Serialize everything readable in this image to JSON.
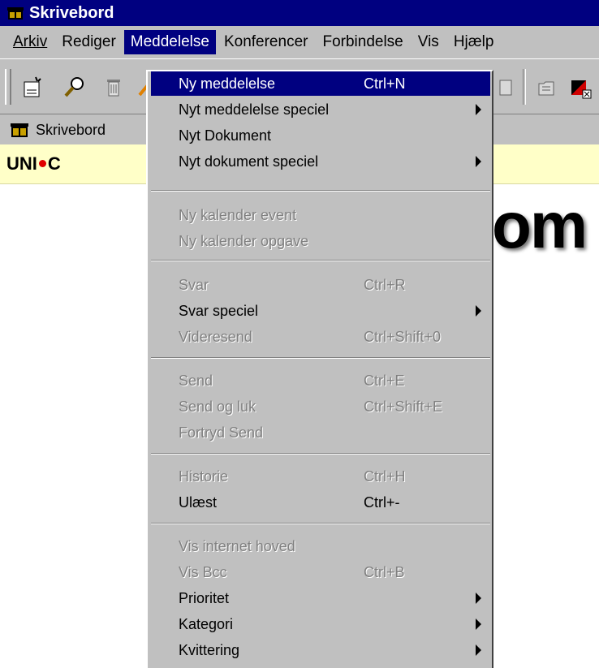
{
  "window": {
    "title": "Skrivebord"
  },
  "menubar": {
    "items": [
      {
        "label": "Arkiv"
      },
      {
        "label": "Rediger"
      },
      {
        "label": "Meddelelse"
      },
      {
        "label": "Konferencer"
      },
      {
        "label": "Forbindelse"
      },
      {
        "label": "Vis"
      },
      {
        "label": "Hjælp"
      }
    ]
  },
  "toolbar": {
    "icons": [
      "new-document-icon",
      "search-icon",
      "delete-icon",
      "paint-icon",
      "document-icon",
      "folder-icon",
      "red-black-icon"
    ]
  },
  "location": {
    "label": "Skrivebord"
  },
  "brand": {
    "left": "UNI",
    "right": "C",
    "dot_color": "#e00000"
  },
  "background_text": "om",
  "dropdown": {
    "items": [
      {
        "label": "Ny meddelelse",
        "shortcut": "Ctrl+N",
        "enabled": true,
        "highlighted": true,
        "submenu": false
      },
      {
        "label": "Nyt meddelelse speciel",
        "shortcut": "",
        "enabled": true,
        "submenu": true
      },
      {
        "label": "Nyt Dokument",
        "shortcut": "",
        "enabled": true,
        "submenu": false
      },
      {
        "label": "Nyt dokument speciel",
        "shortcut": "",
        "enabled": true,
        "submenu": true
      },
      {
        "label": "Ny kalender event",
        "shortcut": "",
        "enabled": false,
        "submenu": false
      },
      {
        "label": "Ny kalender opgave",
        "shortcut": "",
        "enabled": false,
        "submenu": false
      },
      {
        "label": "Svar",
        "shortcut": "Ctrl+R",
        "enabled": false,
        "submenu": false
      },
      {
        "label": "Svar speciel",
        "shortcut": "",
        "enabled": true,
        "submenu": true
      },
      {
        "label": "Videresend",
        "shortcut": "Ctrl+Shift+0",
        "enabled": false,
        "submenu": false
      },
      {
        "label": "Send",
        "shortcut": "Ctrl+E",
        "enabled": false,
        "submenu": false
      },
      {
        "label": "Send og luk",
        "shortcut": "Ctrl+Shift+E",
        "enabled": false,
        "submenu": false
      },
      {
        "label": "Fortryd Send",
        "shortcut": "",
        "enabled": false,
        "submenu": false
      },
      {
        "label": "Historie",
        "shortcut": "Ctrl+H",
        "enabled": false,
        "submenu": false
      },
      {
        "label": "Ulæst",
        "shortcut": "Ctrl+-",
        "enabled": true,
        "submenu": false
      },
      {
        "label": "Vis internet hoved",
        "shortcut": "",
        "enabled": false,
        "submenu": false
      },
      {
        "label": "Vis Bcc",
        "shortcut": "Ctrl+B",
        "enabled": false,
        "submenu": false
      },
      {
        "label": "Prioritet",
        "shortcut": "",
        "enabled": true,
        "submenu": true
      },
      {
        "label": "Kategori",
        "shortcut": "",
        "enabled": true,
        "submenu": true
      },
      {
        "label": "Kvittering",
        "shortcut": "",
        "enabled": true,
        "submenu": true
      }
    ]
  }
}
